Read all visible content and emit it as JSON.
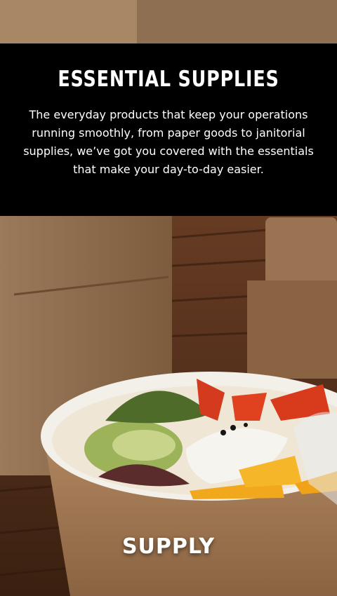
{
  "banner": {
    "title": "ESSENTIAL SUPPLIES",
    "body": "The everyday products that keep your operations running smoothly, from paper goods to janitorial supplies, we’ve got you covered with the essentials that make your day-to-day easier."
  },
  "brand": {
    "label": "SUPPLY"
  },
  "colors": {
    "banner_bg": "#000000",
    "text": "#ffffff",
    "kraft": "#b08a63"
  },
  "photo": {
    "subject": "salad-bowl-kraft-bag-photo"
  }
}
